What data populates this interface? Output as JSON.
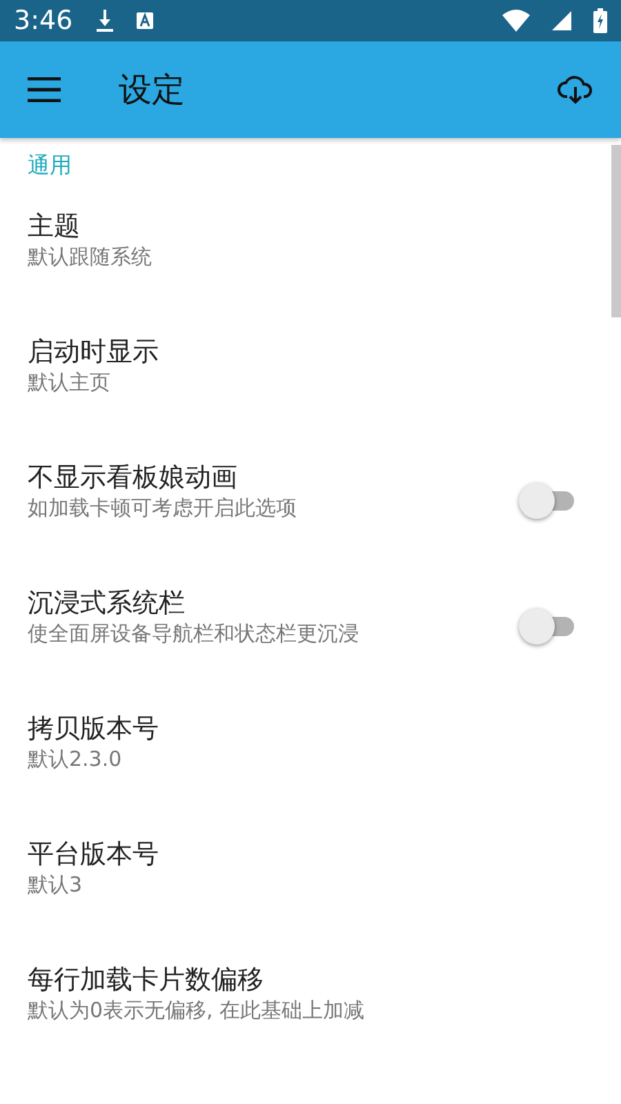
{
  "status_bar": {
    "time": "3:46"
  },
  "app_bar": {
    "title": "设定"
  },
  "section": {
    "title": "通用"
  },
  "items": [
    {
      "kind": "text",
      "title": "主题",
      "summary": "默认跟随系统"
    },
    {
      "kind": "text",
      "title": "启动时显示",
      "summary": "默认主页"
    },
    {
      "kind": "switch",
      "title": "不显示看板娘动画",
      "summary": "如加载卡顿可考虑开启此选项",
      "on": false
    },
    {
      "kind": "switch",
      "title": "沉浸式系统栏",
      "summary": "使全面屏设备导航栏和状态栏更沉浸",
      "on": false
    },
    {
      "kind": "text",
      "title": "拷贝版本号",
      "summary": "默认2.3.0"
    },
    {
      "kind": "text",
      "title": "平台版本号",
      "summary": "默认3"
    },
    {
      "kind": "text",
      "title": "每行加载卡片数偏移",
      "summary": "默认为0表示无偏移, 在此基础上加减"
    }
  ]
}
